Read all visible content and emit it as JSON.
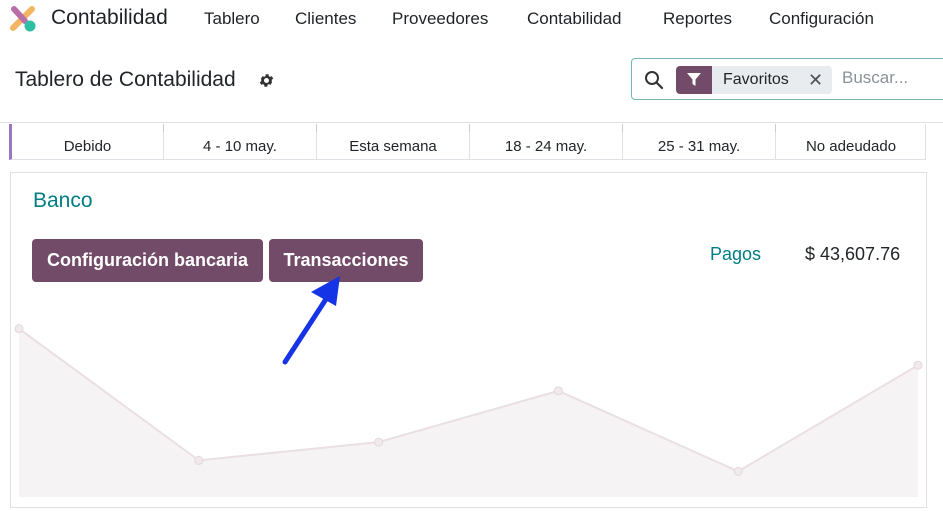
{
  "navbar": {
    "app_name": "Contabilidad",
    "logo_icon": "odoo-accounting-logo",
    "menu": [
      "Tablero",
      "Clientes",
      "Proveedores",
      "Contabilidad",
      "Reportes",
      "Configuración"
    ]
  },
  "control_panel": {
    "page_title": "Tablero de Contabilidad",
    "settings_icon": "gear-icon",
    "search": {
      "facet_icon": "filter-icon",
      "facet_label": "Favoritos",
      "placeholder": "Buscar..."
    }
  },
  "aging": {
    "columns": [
      "Debido",
      "4 - 10 may.",
      "Esta semana",
      "18 - 24 may.",
      "25 - 31 may.",
      "No adeudado"
    ]
  },
  "bank_journal": {
    "title": "Banco",
    "buttons": {
      "bank_config": "Configuración bancaria",
      "transactions": "Transacciones"
    },
    "payments_label": "Pagos",
    "payments_amount": "$ 43,607.76"
  },
  "annotation": {
    "arrow_color": "#1534e6",
    "points_to": "Transacciones"
  },
  "colors": {
    "primary": "#714b67",
    "accent": "#017e84",
    "aging_marker": "#9a77c2",
    "chart_fill": "#f6f3f4",
    "chart_line": "#eadfe3"
  },
  "chart_data": {
    "type": "area",
    "title": "",
    "xlabel": "",
    "ylabel": "",
    "values": [
      92,
      20,
      30,
      58,
      14,
      72
    ],
    "ylim": [
      0,
      100
    ],
    "grid": false,
    "legend": "none"
  }
}
